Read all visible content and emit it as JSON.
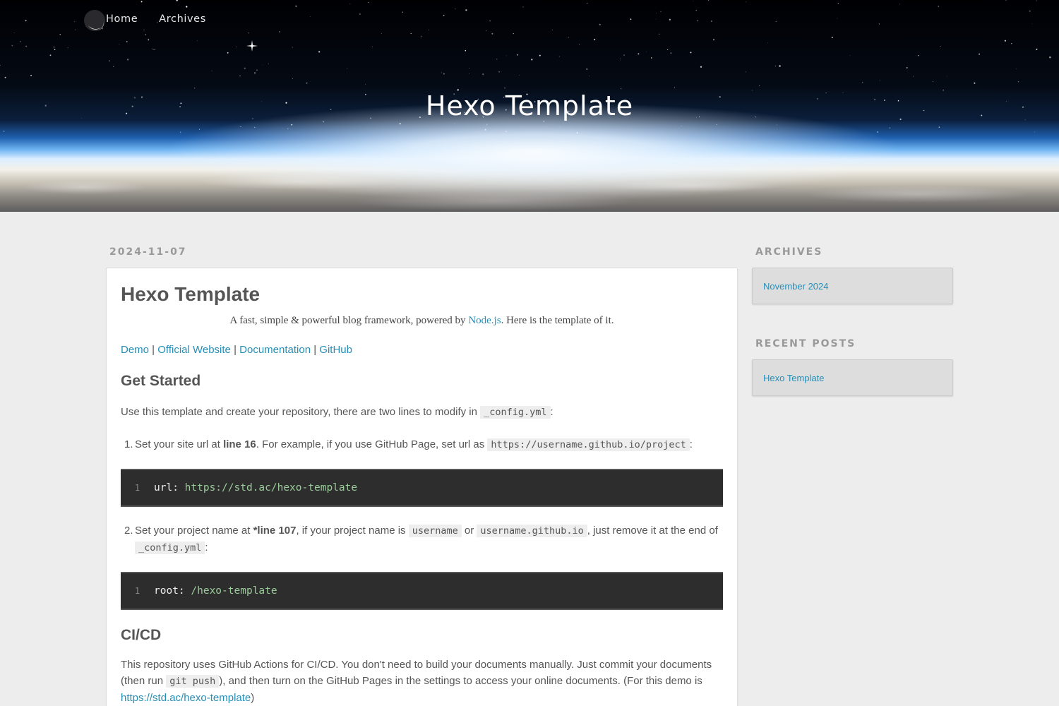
{
  "nav": {
    "items": [
      "Home",
      "Archives"
    ]
  },
  "site": {
    "title": "Hexo Template"
  },
  "post": {
    "date": "2024-11-07",
    "title": "Hexo Template",
    "lead": {
      "before": "A fast, simple & powerful blog framework, powered by ",
      "link": "Node.js",
      "after": ". Here is the template of it."
    },
    "links": [
      "Demo",
      "Official Website",
      "Documentation",
      "GitHub"
    ],
    "link_sep": " | ",
    "get_started": {
      "heading": "Get Started",
      "intro_before": "Use this template and create your repository, there are two lines to modify in ",
      "intro_code": "_config.yml",
      "intro_after": ":",
      "step1": {
        "num": "1.",
        "before": "Set your site url at ",
        "bold": "line 16",
        "middle": ". For example, if you use GitHub Page, set url as ",
        "code": "https://username.github.io/project",
        "after": ":"
      },
      "code1": {
        "line": "1",
        "key": "url:",
        "value": "https://std.ac/hexo-template"
      },
      "step2": {
        "num": "2.",
        "before": "Set your project name at ",
        "bold": "*line 107",
        "middle": ", if your project name is ",
        "code_a": "username",
        "or": " or ",
        "code_b": "username.github.io",
        "middle2": ", just remove it at the end of ",
        "code_c": "_config.yml",
        "after": ":"
      },
      "code2": {
        "line": "1",
        "key": "root:",
        "value": "/hexo-template"
      }
    },
    "cicd": {
      "heading": "CI/CD",
      "text_before": "This repository uses GitHub Actions for CI/CD. You don't need to build your documents manually. Just commit your documents (then run ",
      "code": "git push",
      "text_after": "), and then turn on the GitHub Pages in the settings to access your online documents. (For this demo is",
      "partial_link": "https://std.ac/hexo-template",
      "partial_after": ")"
    }
  },
  "sidebar": {
    "archives": {
      "title": "ARCHIVES",
      "items": [
        "November 2024"
      ]
    },
    "recent": {
      "title": "RECENT POSTS",
      "items": [
        "Hexo Template"
      ]
    }
  },
  "colors": {
    "link": "#258fb8",
    "code_bg": "#2d2d2d",
    "code_value": "#99cc99",
    "page_bg": "#ededed"
  }
}
